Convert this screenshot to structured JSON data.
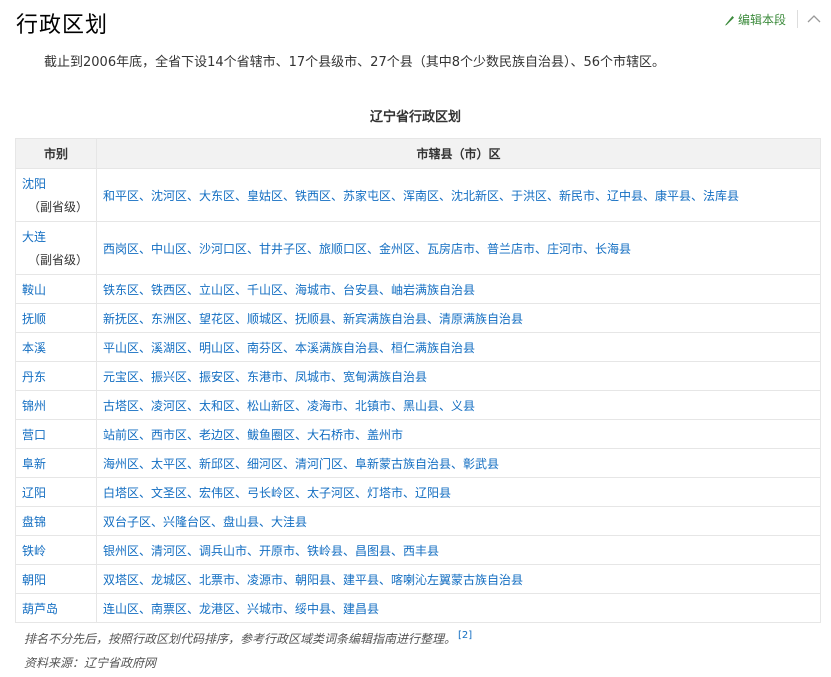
{
  "header": {
    "title": "行政区划",
    "edit_label": "编辑本段"
  },
  "intro": "截止到2006年底，全省下设14个省辖市、17个县级市、27个县（其中8个少数民族自治县）、56个市辖区。",
  "table": {
    "caption": "辽宁省行政区划",
    "headers": {
      "city": "市别",
      "districts": "市辖县（市）区"
    },
    "rows": [
      {
        "city": "沈阳",
        "note": "（副省级）",
        "districts": "和平区、沈河区、大东区、皇姑区、铁西区、苏家屯区、浑南区、沈北新区、于洪区、新民市、辽中县、康平县、法库县"
      },
      {
        "city": "大连",
        "note": "（副省级）",
        "districts": "西岗区、中山区、沙河口区、甘井子区、旅顺口区、金州区、瓦房店市、普兰店市、庄河市、长海县"
      },
      {
        "city": "鞍山",
        "districts": "铁东区、铁西区、立山区、千山区、海城市、台安县、岫岩满族自治县"
      },
      {
        "city": "抚顺",
        "districts": "新抚区、东洲区、望花区、顺城区、抚顺县、新宾满族自治县、清原满族自治县"
      },
      {
        "city": "本溪",
        "districts": "平山区、溪湖区、明山区、南芬区、本溪满族自治县、桓仁满族自治县"
      },
      {
        "city": "丹东",
        "districts": "元宝区、振兴区、振安区、东港市、凤城市、宽甸满族自治县"
      },
      {
        "city": "锦州",
        "districts": "古塔区、凌河区、太和区、松山新区、凌海市、北镇市、黑山县、义县"
      },
      {
        "city": "营口",
        "districts": "站前区、西市区、老边区、鲅鱼圈区、大石桥市、盖州市"
      },
      {
        "city": "阜新",
        "districts": "海州区、太平区、新邱区、细河区、清河门区、阜新蒙古族自治县、彰武县"
      },
      {
        "city": "辽阳",
        "districts": "白塔区、文圣区、宏伟区、弓长岭区、太子河区、灯塔市、辽阳县"
      },
      {
        "city": "盘锦",
        "districts": "双台子区、兴隆台区、盘山县、大洼县"
      },
      {
        "city": "铁岭",
        "districts": "银州区、清河区、调兵山市、开原市、铁岭县、昌图县、西丰县"
      },
      {
        "city": "朝阳",
        "districts": "双塔区、龙城区、北票市、凌源市、朝阳县、建平县、喀喇沁左翼蒙古族自治县"
      },
      {
        "city": "葫芦岛",
        "districts": "连山区、南票区、龙港区、兴城市、绥中县、建昌县"
      }
    ]
  },
  "footnote": {
    "text": "排名不分先后，按照行政区划代码排序，参考行政区域类词条编辑指南进行整理。",
    "ref": "[2]"
  },
  "source": "资料来源：辽宁省政府网",
  "colors": {
    "link": "#136ec2",
    "edit": "#3c8b3c",
    "header_bg": "#f2f2f2",
    "border": "#e6e6e6"
  }
}
